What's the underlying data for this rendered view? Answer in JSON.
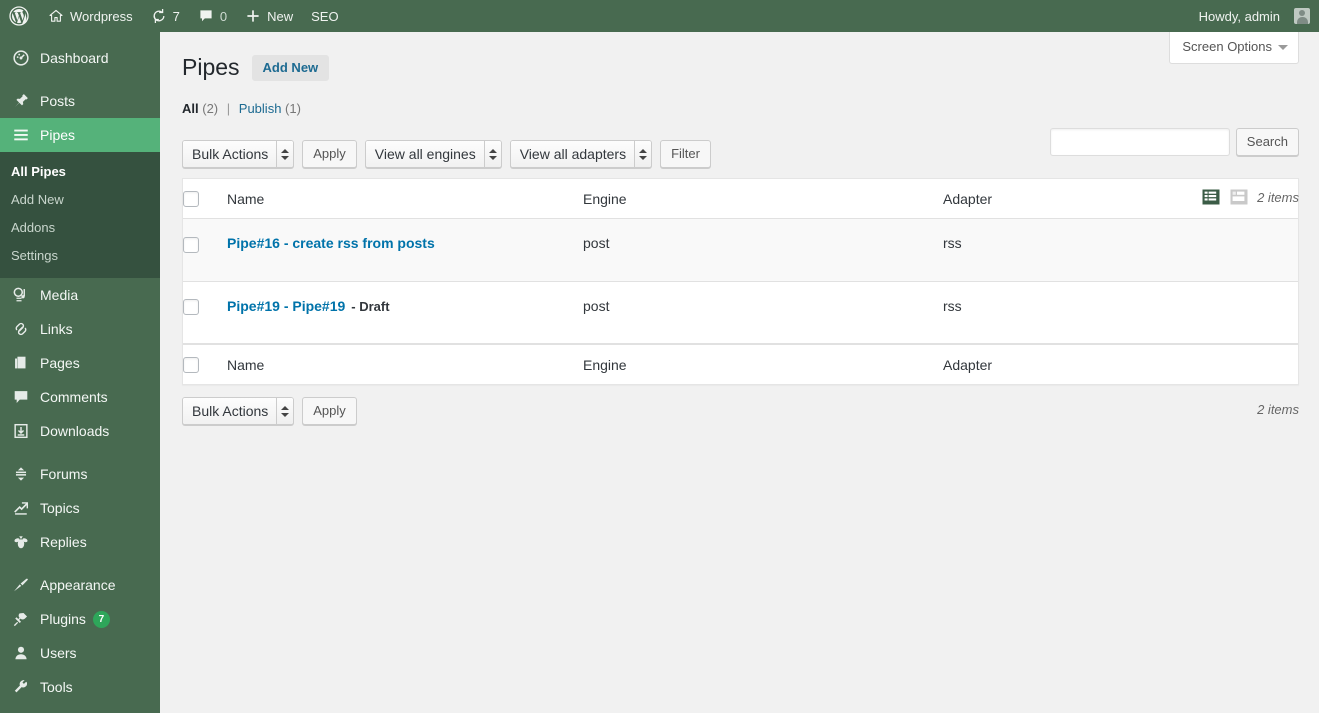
{
  "adminbar": {
    "logo_icon": "wordpress-logo-icon",
    "site_name": "Wordpress",
    "site_icon": "home-icon",
    "updates_icon": "updates-icon",
    "updates_count": "7",
    "comments_icon": "comment-bubble-icon",
    "comments_count": "0",
    "new_icon": "plus-icon",
    "new_label": "New",
    "seo_label": "SEO",
    "howdy": "Howdy, admin",
    "avatar_icon": "avatar-icon"
  },
  "sidebar": {
    "items": [
      {
        "label": "Dashboard",
        "icon": "dashboard-gauge-icon",
        "current": false
      },
      {
        "label": "Posts",
        "icon": "pushpin-icon",
        "current": false
      },
      {
        "label": "Pipes",
        "icon": "menu-lines-icon",
        "current": true
      },
      {
        "label": "Media",
        "icon": "media-music-icon",
        "current": false
      },
      {
        "label": "Links",
        "icon": "link-chain-icon",
        "current": false
      },
      {
        "label": "Pages",
        "icon": "pages-icon",
        "current": false
      },
      {
        "label": "Comments",
        "icon": "comment-bubble-icon",
        "current": false
      },
      {
        "label": "Downloads",
        "icon": "download-icon",
        "current": false
      },
      {
        "label": "Forums",
        "icon": "forums-icon",
        "current": false
      },
      {
        "label": "Topics",
        "icon": "topics-icon",
        "current": false
      },
      {
        "label": "Replies",
        "icon": "replies-bee-icon",
        "current": false
      },
      {
        "label": "Appearance",
        "icon": "paintbrush-icon",
        "current": false
      },
      {
        "label": "Plugins",
        "icon": "plug-icon",
        "current": false,
        "badge": "7"
      },
      {
        "label": "Users",
        "icon": "user-icon",
        "current": false
      },
      {
        "label": "Tools",
        "icon": "wrench-icon",
        "current": false
      }
    ],
    "submenu": [
      {
        "label": "All Pipes",
        "current": true
      },
      {
        "label": "Add New",
        "current": false
      },
      {
        "label": "Addons",
        "current": false
      },
      {
        "label": "Settings",
        "current": false
      }
    ]
  },
  "screen_options": {
    "label": "Screen Options",
    "caret_icon": "chevron-down-icon"
  },
  "page": {
    "title": "Pipes",
    "add_new_label": "Add New"
  },
  "views": {
    "all_label": "All",
    "all_count": "(2)",
    "divider": "|",
    "publish_label": "Publish",
    "publish_count": "(1)"
  },
  "search": {
    "value": "",
    "placeholder": "",
    "button_label": "Search"
  },
  "view_switch": {
    "list_icon": "list-view-icon",
    "excerpt_icon": "excerpt-view-icon",
    "items_count": "2 items"
  },
  "tablenav_top": {
    "bulk_actions_label": "Bulk Actions",
    "apply_label": "Apply",
    "engines_filter_label": "View all engines",
    "adapters_filter_label": "View all adapters",
    "filter_label": "Filter"
  },
  "tablenav_bottom": {
    "bulk_actions_label": "Bulk Actions",
    "apply_label": "Apply",
    "items_count": "2 items"
  },
  "table": {
    "columns": {
      "name": "Name",
      "engine": "Engine",
      "adapter": "Adapter"
    },
    "rows": [
      {
        "name": "Pipe#16 - create rss from posts",
        "state": "",
        "engine": "post",
        "adapter": "rss"
      },
      {
        "name": "Pipe#19 - Pipe#19",
        "state": "- Draft",
        "engine": "post",
        "adapter": "rss"
      }
    ]
  },
  "colors": {
    "admin_bar": "#486a50",
    "sidebar": "#486a50",
    "sidebar_current": "#55b27a",
    "submenu_bg": "#35513f",
    "link": "#0073aa",
    "badge": "#2ea65a",
    "body_bg": "#f1f1f1"
  }
}
